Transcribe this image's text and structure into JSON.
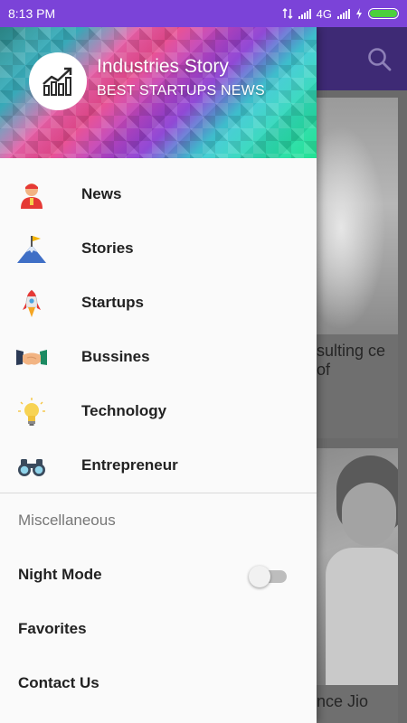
{
  "status_bar": {
    "time": "8:13 PM",
    "network": "4G",
    "battery_level": 1.0
  },
  "background_app": {
    "card1_text": "sulting ce of",
    "card2_text": "nce Jio",
    "search_icon": "search-icon"
  },
  "drawer": {
    "header": {
      "title": "Industries Story",
      "subtitle": "BEST STARTUPS NEWS",
      "logo_icon": "bar-chart-icon"
    },
    "main_items": [
      {
        "label": "News",
        "icon": "reporter-icon"
      },
      {
        "label": "Stories",
        "icon": "mountain-flag-icon"
      },
      {
        "label": "Startups",
        "icon": "rocket-icon"
      },
      {
        "label": "Bussines",
        "icon": "handshake-icon"
      },
      {
        "label": "Technology",
        "icon": "lightbulb-icon"
      },
      {
        "label": "Entrepreneur",
        "icon": "binoculars-icon"
      }
    ],
    "section_header": "Miscellaneous",
    "misc_items": [
      {
        "label": "Night Mode",
        "toggle": false
      },
      {
        "label": "Favorites"
      },
      {
        "label": "Contact Us"
      }
    ]
  },
  "colors": {
    "status_bar": "#7b43d8",
    "toolbar": "#3e2a75",
    "battery_fill": "#4ccf3d"
  }
}
